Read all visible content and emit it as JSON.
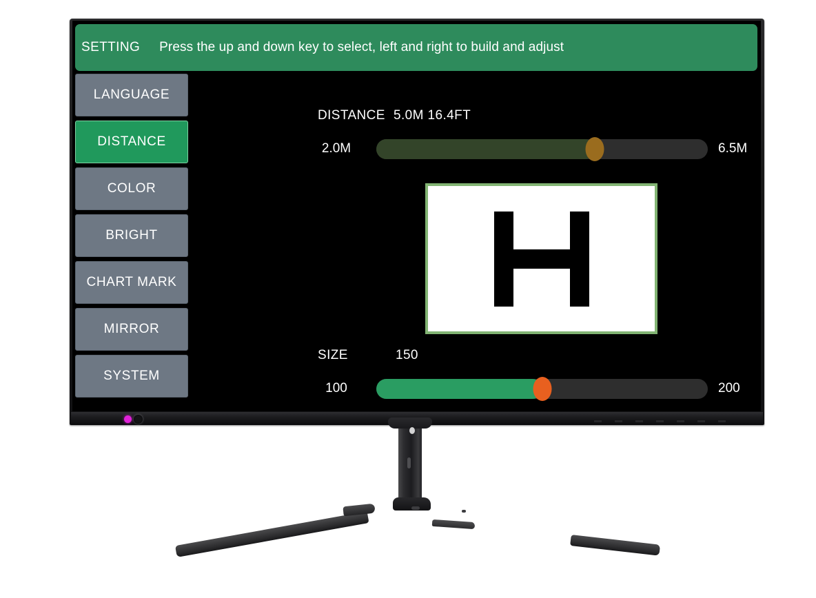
{
  "osd": {
    "header": {
      "title": "SETTING",
      "hint": "Press the up and down key to select, left and right to build and adjust"
    },
    "menu": {
      "items": [
        {
          "label": "LANGUAGE",
          "active": false
        },
        {
          "label": "DISTANCE",
          "active": true
        },
        {
          "label": "COLOR",
          "active": false
        },
        {
          "label": "BRIGHT",
          "active": false
        },
        {
          "label": "CHART MARK",
          "active": false
        },
        {
          "label": "MIRROR",
          "active": false
        },
        {
          "label": "SYSTEM",
          "active": false
        }
      ]
    },
    "distance": {
      "label": "DISTANCE",
      "value": "5.0M 16.4FT",
      "min_label": "2.0M",
      "max_label": "6.5M",
      "fill_percent": "66",
      "thumb_percent": "66"
    },
    "size": {
      "label": "SIZE",
      "value": "150",
      "min_label": "100",
      "max_label": "200",
      "fill_percent": "50",
      "thumb_percent": "50"
    },
    "chart_preview": {
      "optotype": "H",
      "border_color": "#82b473",
      "background_color": "#ffffff"
    },
    "colors": {
      "header_green": "#2e8b5c",
      "menu_gray": "#6e7884",
      "menu_active_green": "#20995c",
      "distance_fill": "#334429",
      "distance_thumb": "#9a6c1e",
      "size_fill": "#2a9d62",
      "size_thumb": "#e8601f",
      "track": "#2e2e2e",
      "screen_background": "#000000"
    }
  },
  "hardware": {
    "power_led_color": "#e022d8",
    "bezel_button": "power-button"
  }
}
